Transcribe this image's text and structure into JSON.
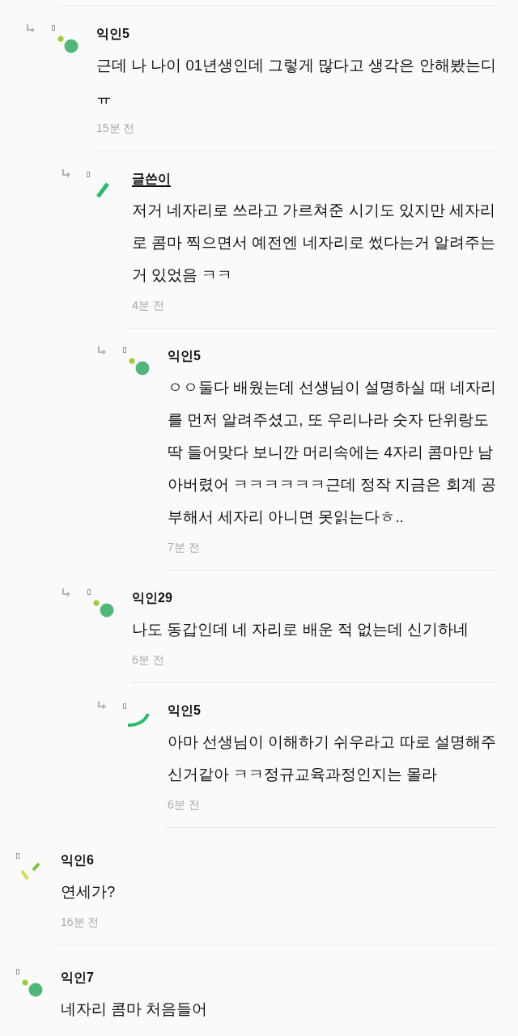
{
  "thread_continued": {
    "replies": [
      {
        "author": "익인5",
        "op": false,
        "kind": "dots",
        "text": "근데 나 나이 01년생인데 그렇게 많다고 생각은 안해봤는디ㅠ",
        "time": "15분 전",
        "children": [
          {
            "author": "글쓴이",
            "op": true,
            "kind": "bar",
            "text": "저거 네자리로 쓰라고 가르쳐준 시기도 있지만 세자리로 콤마 찍으면서 예전엔 네자리로 썼다는거 알려주는거 있었음 ㅋㅋ",
            "time": "4분 전",
            "children": [
              {
                "author": "익인5",
                "op": false,
                "kind": "dots",
                "text": "ㅇㅇ둘다 배웠는데 선생님이 설명하실 때 네자리를 먼저 알려주셨고, 또 우리나라 숫자 단위랑도 딱 들어맞다 보니깐 머리속에는 4자리 콤마만 남아버렸어 ㅋㅋㅋㅋㅋㅋ근데 정작 지금은 회계 공부해서 세자리 아니면 못읽는다ㅎ..",
                "time": "7분 전"
              }
            ]
          },
          {
            "author": "익인29",
            "op": false,
            "kind": "dots",
            "text": "나도 동갑인데 네 자리로 배운 적 없는데 신기하네",
            "time": "6분 전",
            "children": [
              {
                "author": "익인5",
                "op": false,
                "kind": "arc",
                "text": "아마 선생님이 이해하기 쉬우라고 따로 설명해주신거같아 ㅋㅋ정규교육과정인지는 몰라",
                "time": "6분 전"
              }
            ]
          }
        ]
      }
    ]
  },
  "comments": [
    {
      "author": "익인6",
      "op": false,
      "kind": "ticks",
      "text": "연세가?",
      "time": "16분 전"
    },
    {
      "author": "익인7",
      "op": false,
      "kind": "dots",
      "text": "네자리 콤마 처음들어"
    }
  ]
}
